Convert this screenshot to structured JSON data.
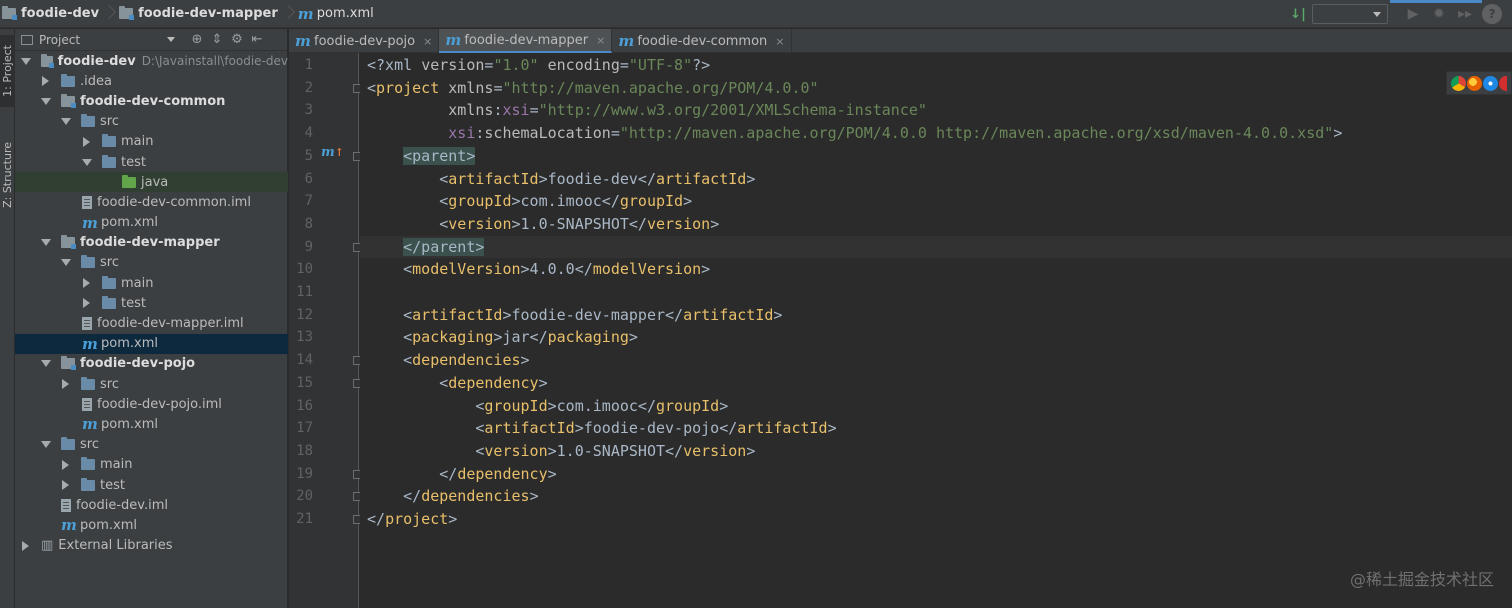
{
  "navbar": {
    "crumbs": [
      "foodie-dev",
      "foodie-dev-mapper",
      "pom.xml"
    ]
  },
  "left_stripe": {
    "project_label": "1: Project",
    "structure_label": "Z: Structure"
  },
  "project_panel": {
    "title": "Project",
    "tools": [
      "⊕",
      "⇕",
      "⚙",
      "⇤"
    ],
    "tree": [
      {
        "label": "foodie-dev",
        "path": "D:\\Javainstall\\foodie-dev",
        "bold": true
      },
      {
        "label": ".idea"
      },
      {
        "label": "foodie-dev-common",
        "bold": true
      },
      {
        "label": "src"
      },
      {
        "label": "main"
      },
      {
        "label": "test"
      },
      {
        "label": "java"
      },
      {
        "label": "foodie-dev-common.iml"
      },
      {
        "label": "pom.xml"
      },
      {
        "label": "foodie-dev-mapper",
        "bold": true
      },
      {
        "label": "src"
      },
      {
        "label": "main"
      },
      {
        "label": "test"
      },
      {
        "label": "foodie-dev-mapper.iml"
      },
      {
        "label": "pom.xml"
      },
      {
        "label": "foodie-dev-pojo",
        "bold": true
      },
      {
        "label": "src"
      },
      {
        "label": "foodie-dev-pojo.iml"
      },
      {
        "label": "pom.xml"
      },
      {
        "label": "src"
      },
      {
        "label": "main"
      },
      {
        "label": "test"
      },
      {
        "label": "foodie-dev.iml"
      },
      {
        "label": "pom.xml"
      },
      {
        "label": "External Libraries"
      }
    ]
  },
  "tabs": [
    {
      "label": "foodie-dev-pojo",
      "close": "×"
    },
    {
      "label": "foodie-dev-mapper",
      "close": "×"
    },
    {
      "label": "foodie-dev-common",
      "close": "×"
    }
  ],
  "editor": {
    "line_numbers": [
      "1",
      "2",
      "3",
      "4",
      "5",
      "6",
      "7",
      "8",
      "9",
      "10",
      "11",
      "12",
      "13",
      "14",
      "15",
      "16",
      "17",
      "18",
      "19",
      "20",
      "21"
    ],
    "lines": [
      [
        [
          "t-text",
          "<?xml "
        ],
        [
          "t-attr",
          "version"
        ],
        [
          "t-text",
          "="
        ],
        [
          "t-val",
          "\"1.0\""
        ],
        [
          "t-text",
          " "
        ],
        [
          "t-attr",
          "encoding"
        ],
        [
          "t-text",
          "="
        ],
        [
          "t-val",
          "\"UTF-8\""
        ],
        [
          "t-text",
          "?>"
        ]
      ],
      [
        [
          "t-text",
          "<"
        ],
        [
          "t-tag",
          "project"
        ],
        [
          "t-text",
          " "
        ],
        [
          "t-attr",
          "xmlns"
        ],
        [
          "t-text",
          "="
        ],
        [
          "t-val",
          "\"http://maven.apache.org/POM/4.0.0\""
        ]
      ],
      [
        [
          "t-text",
          "         "
        ],
        [
          "t-attr",
          "xmlns"
        ],
        [
          "t-text",
          ":"
        ],
        [
          "t-ns",
          "xsi"
        ],
        [
          "t-text",
          "="
        ],
        [
          "t-val",
          "\"http://www.w3.org/2001/XMLSchema-instance\""
        ]
      ],
      [
        [
          "t-text",
          "         "
        ],
        [
          "t-ns",
          "xsi"
        ],
        [
          "t-text",
          ":"
        ],
        [
          "t-attr",
          "schemaLocation"
        ],
        [
          "t-text",
          "="
        ],
        [
          "t-val",
          "\"http://maven.apache.org/POM/4.0.0 http://maven.apache.org/xsd/maven-4.0.0.xsd\""
        ],
        [
          "t-text",
          ">"
        ]
      ],
      [
        [
          "t-text",
          "    "
        ],
        [
          "t-match",
          "<parent>"
        ]
      ],
      [
        [
          "t-text",
          "        <"
        ],
        [
          "t-tag",
          "artifactId"
        ],
        [
          "t-text",
          ">foodie-dev</"
        ],
        [
          "t-tag",
          "artifactId"
        ],
        [
          "t-text",
          ">"
        ]
      ],
      [
        [
          "t-text",
          "        <"
        ],
        [
          "t-tag",
          "groupId"
        ],
        [
          "t-text",
          ">com.imooc</"
        ],
        [
          "t-tag",
          "groupId"
        ],
        [
          "t-text",
          ">"
        ]
      ],
      [
        [
          "t-text",
          "        <"
        ],
        [
          "t-tag",
          "version"
        ],
        [
          "t-text",
          ">1.0-SNAPSHOT</"
        ],
        [
          "t-tag",
          "version"
        ],
        [
          "t-text",
          ">"
        ]
      ],
      [
        [
          "t-text",
          "    "
        ],
        [
          "t-match",
          "</parent>"
        ]
      ],
      [
        [
          "t-text",
          "    <"
        ],
        [
          "t-tag",
          "modelVersion"
        ],
        [
          "t-text",
          ">4.0.0</"
        ],
        [
          "t-tag",
          "modelVersion"
        ],
        [
          "t-text",
          ">"
        ]
      ],
      [
        [
          "t-text",
          ""
        ]
      ],
      [
        [
          "t-text",
          "    <"
        ],
        [
          "t-tag",
          "artifactId"
        ],
        [
          "t-text",
          ">foodie-dev-mapper</"
        ],
        [
          "t-tag",
          "artifactId"
        ],
        [
          "t-text",
          ">"
        ]
      ],
      [
        [
          "t-text",
          "    <"
        ],
        [
          "t-tag",
          "packaging"
        ],
        [
          "t-text",
          ">jar</"
        ],
        [
          "t-tag",
          "packaging"
        ],
        [
          "t-text",
          ">"
        ]
      ],
      [
        [
          "t-text",
          "    <"
        ],
        [
          "t-tag",
          "dependencies"
        ],
        [
          "t-text",
          ">"
        ]
      ],
      [
        [
          "t-text",
          "        <"
        ],
        [
          "t-tag",
          "dependency"
        ],
        [
          "t-text",
          ">"
        ]
      ],
      [
        [
          "t-text",
          "            <"
        ],
        [
          "t-tag",
          "groupId"
        ],
        [
          "t-text",
          ">com.imooc</"
        ],
        [
          "t-tag",
          "groupId"
        ],
        [
          "t-text",
          ">"
        ]
      ],
      [
        [
          "t-text",
          "            <"
        ],
        [
          "t-tag",
          "artifactId"
        ],
        [
          "t-text",
          ">foodie-dev-pojo</"
        ],
        [
          "t-tag",
          "artifactId"
        ],
        [
          "t-text",
          ">"
        ]
      ],
      [
        [
          "t-text",
          "            <"
        ],
        [
          "t-tag",
          "version"
        ],
        [
          "t-text",
          ">1.0-SNAPSHOT</"
        ],
        [
          "t-tag",
          "version"
        ],
        [
          "t-text",
          ">"
        ]
      ],
      [
        [
          "t-text",
          "        </"
        ],
        [
          "t-tag",
          "dependency"
        ],
        [
          "t-text",
          ">"
        ]
      ],
      [
        [
          "t-text",
          "    </"
        ],
        [
          "t-tag",
          "dependencies"
        ],
        [
          "t-text",
          ">"
        ]
      ],
      [
        [
          "t-text",
          "</"
        ],
        [
          "t-tag",
          "project"
        ],
        [
          "t-text",
          ">"
        ]
      ]
    ]
  },
  "watermark": "@稀土掘金技术社区",
  "colors": {
    "accent": "#4a88c7",
    "tag": "#e8bf6a",
    "string": "#6a8759",
    "namespace": "#9876aa"
  }
}
